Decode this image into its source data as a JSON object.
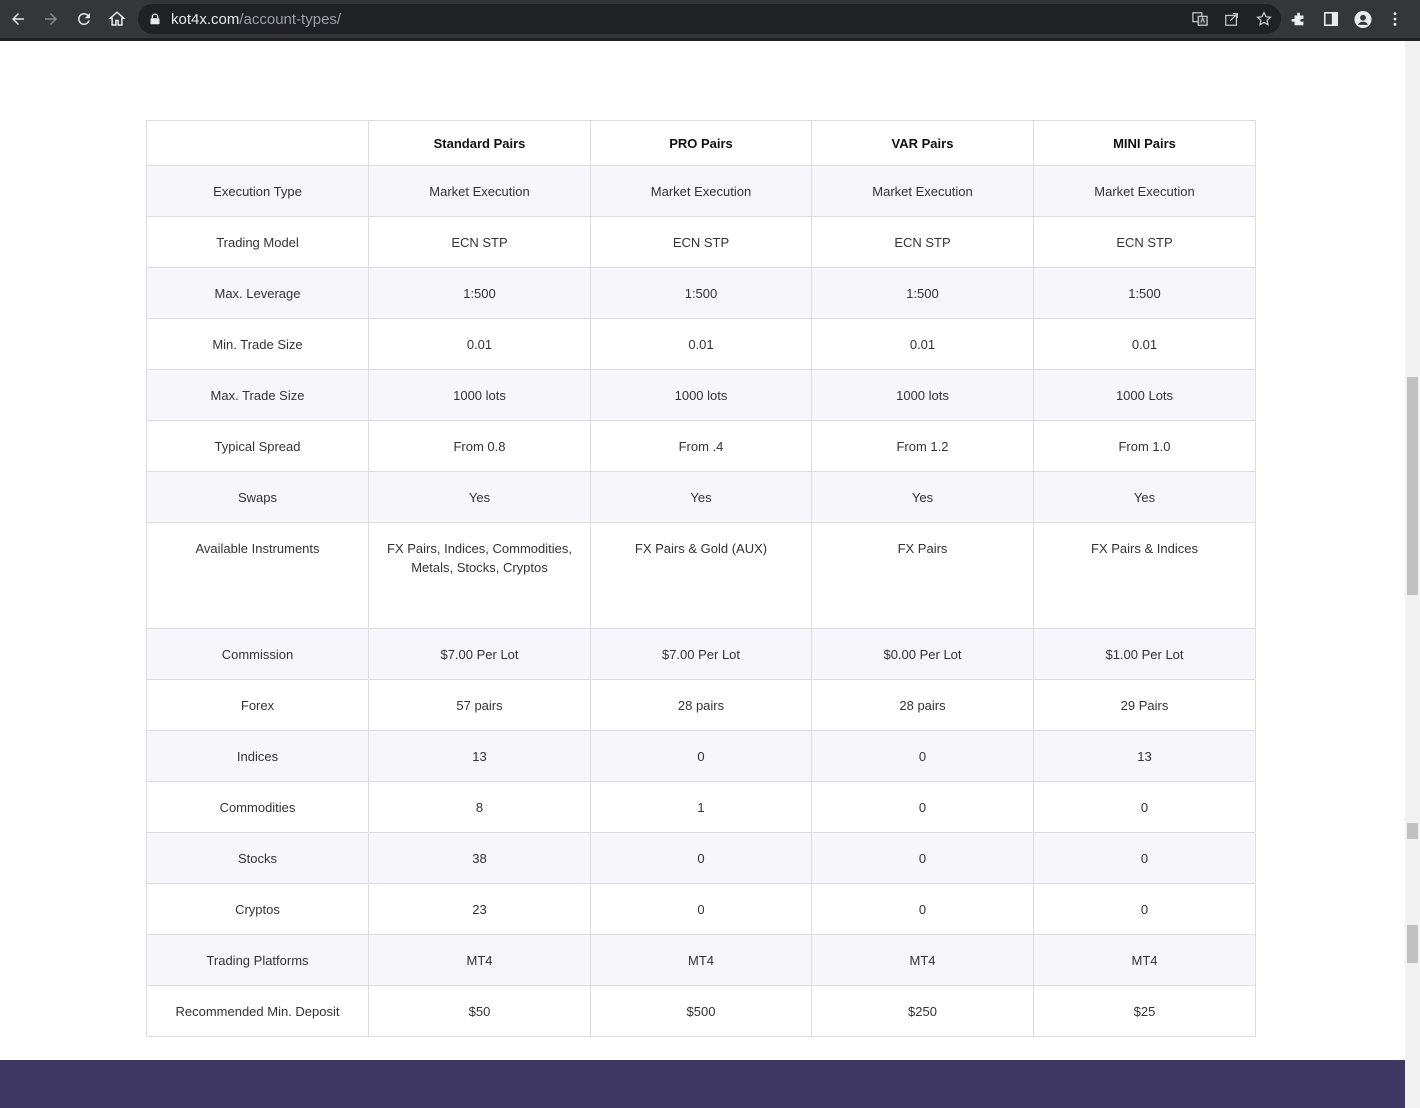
{
  "browser": {
    "url_host": "kot4x.com",
    "url_path": "/account-types/"
  },
  "table": {
    "headers": [
      "",
      "Standard Pairs",
      "PRO Pairs",
      "VAR Pairs",
      "MINI Pairs"
    ],
    "rows": [
      [
        "Execution Type",
        "Market Execution",
        "Market Execution",
        "Market Execution",
        "Market Execution"
      ],
      [
        "Trading Model",
        "ECN STP",
        "ECN STP",
        "ECN STP",
        "ECN STP"
      ],
      [
        "Max. Leverage",
        "1:500",
        "1:500",
        "1:500",
        "1:500"
      ],
      [
        "Min. Trade Size",
        "0.01",
        "0.01",
        "0.01",
        "0.01"
      ],
      [
        "Max. Trade Size",
        "1000 lots",
        "1000 lots",
        "1000 lots",
        "1000 Lots"
      ],
      [
        "Typical Spread",
        "From 0.8",
        "From .4",
        "From 1.2",
        "From 1.0"
      ],
      [
        "Swaps",
        "Yes",
        "Yes",
        "Yes",
        "Yes"
      ],
      [
        "Available Instruments",
        "FX Pairs, Indices, Commodities, Metals, Stocks, Cryptos",
        "FX Pairs & Gold (AUX)",
        "FX Pairs",
        "FX Pairs & Indices"
      ],
      [
        "Commission",
        "$7.00 Per Lot",
        "$7.00 Per Lot",
        "$0.00 Per Lot",
        "$1.00 Per Lot"
      ],
      [
        "Forex",
        "57 pairs",
        "28 pairs",
        "28 pairs",
        "29 Pairs"
      ],
      [
        "Indices",
        "13",
        "0",
        "0",
        "13"
      ],
      [
        "Commodities",
        "8",
        "1",
        "0",
        "0"
      ],
      [
        "Stocks",
        "38",
        "0",
        "0",
        "0"
      ],
      [
        "Cryptos",
        "23",
        "0",
        "0",
        "0"
      ],
      [
        "Trading Platforms",
        "MT4",
        "MT4",
        "MT4",
        "MT4"
      ],
      [
        "Recommended Min. Deposit",
        "$50",
        "$500",
        "$250",
        "$25"
      ]
    ]
  }
}
